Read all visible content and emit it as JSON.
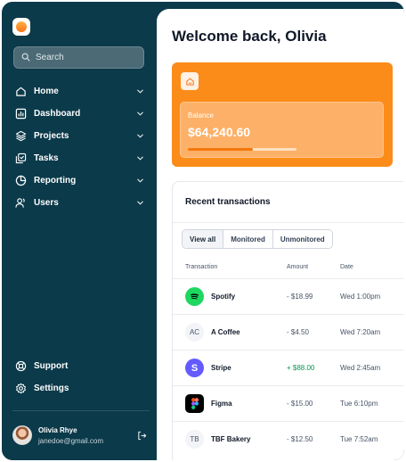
{
  "sidebar": {
    "search_placeholder": "Search",
    "items": [
      {
        "label": "Home",
        "icon": "home-icon"
      },
      {
        "label": "Dashboard",
        "icon": "bar-chart-icon"
      },
      {
        "label": "Projects",
        "icon": "layers-icon"
      },
      {
        "label": "Tasks",
        "icon": "check-square-icon"
      },
      {
        "label": "Reporting",
        "icon": "pie-chart-icon"
      },
      {
        "label": "Users",
        "icon": "users-icon"
      }
    ],
    "bottom_items": [
      {
        "label": "Support",
        "icon": "life-buoy-icon"
      },
      {
        "label": "Settings",
        "icon": "gear-icon"
      }
    ],
    "user": {
      "name": "Olivia Rhye",
      "email": "janedoe@gmail.com"
    }
  },
  "main": {
    "welcome": "Welcome back, Olivia",
    "balance": {
      "label": "Balance",
      "value": "$64,240.60",
      "progress": 0.6
    },
    "transactions": {
      "title": "Recent transactions",
      "filters": [
        "View all",
        "Monitored",
        "Unmonitored"
      ],
      "active_filter": "View all",
      "columns": [
        "Transaction",
        "Amount",
        "Date"
      ],
      "rows": [
        {
          "name": "Spotify",
          "amount": "- $18.99",
          "date": "Wed 1:00pm",
          "logo": "spotify-icon",
          "badge": ""
        },
        {
          "name": "A Coffee",
          "amount": "- $4.50",
          "date": "Wed 7:20am",
          "logo": "initials-avatar",
          "badge": "AC"
        },
        {
          "name": "Stripe",
          "amount": "+ $88.00",
          "date": "Wed 2:45am",
          "logo": "stripe-icon",
          "badge": "S"
        },
        {
          "name": "Figma",
          "amount": "- $15.00",
          "date": "Tue 6:10pm",
          "logo": "figma-icon",
          "badge": ""
        },
        {
          "name": "TBF Bakery",
          "amount": "- $12.50",
          "date": "Tue 7:52am",
          "logo": "initials-avatar",
          "badge": "TB"
        }
      ]
    }
  },
  "colors": {
    "sidebar_bg": "#0b3a4a",
    "accent_orange": "#fb8c1a",
    "positive": "#039855"
  }
}
